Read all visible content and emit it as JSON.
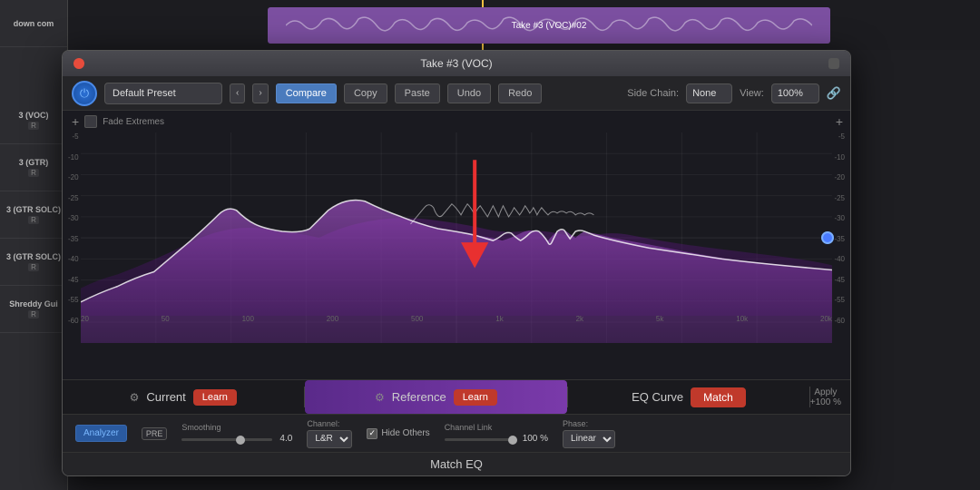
{
  "daw": {
    "tracks": [
      {
        "name": "3 (VOC)",
        "r": "R"
      },
      {
        "name": "3 (GTR)",
        "r": "R"
      },
      {
        "name": "3 (GTR SOLC)",
        "r": "R"
      },
      {
        "name": "3 (GTR SOLC)",
        "r": "R"
      },
      {
        "name": "Shreddy Gui",
        "r": "R"
      }
    ],
    "left_text": "down com"
  },
  "plugin": {
    "title": "Take #3 (VOC)",
    "clip_label": "Take #3 (VOC)#02",
    "preset": {
      "label": "Default Preset"
    },
    "buttons": {
      "compare": "Compare",
      "copy": "Copy",
      "paste": "Paste",
      "undo": "Undo",
      "redo": "Redo"
    },
    "sidechain": {
      "label": "Side Chain:",
      "value": "None"
    },
    "view": {
      "label": "View:",
      "value": "100%"
    },
    "fade_extremes": "Fade Extremes",
    "db_labels_right": [
      "-5",
      "-10",
      "-20",
      "-25",
      "-30",
      "-35",
      "-40",
      "-45",
      "-55",
      "-60"
    ],
    "db_labels_left": [
      "-5",
      "-10",
      "-20",
      "-25",
      "-30",
      "-35",
      "-40",
      "-45",
      "-55",
      "-60"
    ],
    "freq_labels": [
      "20",
      "50",
      "100",
      "200",
      "500",
      "1k",
      "2k",
      "5k",
      "10k",
      "20k"
    ],
    "sections": {
      "current": "Current",
      "reference": "Reference",
      "eq_curve": "EQ Curve"
    },
    "learn_btn": "Learn",
    "match_btn": "Match",
    "apply_label": "Apply",
    "apply_value": "+100 %",
    "bottom": {
      "analyzer": "Analyzer",
      "pre": "PRE",
      "smoothing_label": "Smoothing",
      "smoothing_value": "4.0",
      "channel_label": "Channel:",
      "channel_value": "L&R",
      "hide_others": "Hide Others",
      "channel_link_label": "Channel Link",
      "channel_link_value": "100 %",
      "phase_label": "Phase:",
      "phase_value": "Linear"
    },
    "footer": "Match EQ"
  }
}
